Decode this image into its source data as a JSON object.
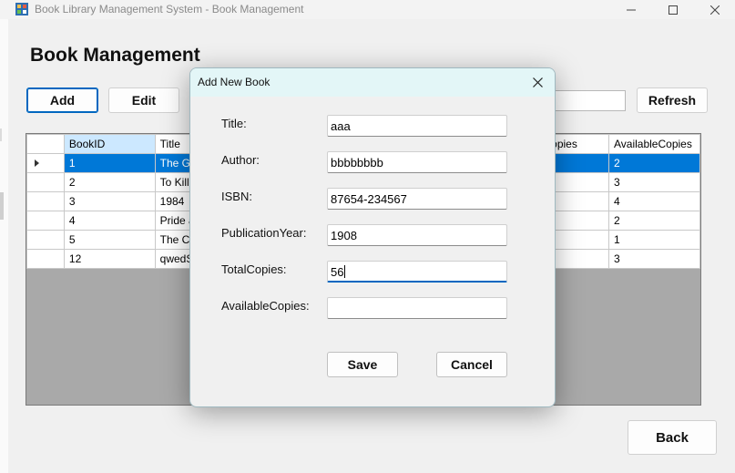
{
  "window": {
    "title": "Book Library Management System - Book Management",
    "app_icon": "app-icon",
    "controls": [
      "minimize-icon",
      "maximize-icon",
      "close-icon"
    ]
  },
  "page": {
    "title": "Book Management"
  },
  "toolbar": {
    "add_label": "Add",
    "edit_label": "Edit",
    "refresh_label": "Refresh",
    "search_value": ""
  },
  "grid": {
    "columns": [
      "BookID",
      "Title",
      "",
      "opies",
      "AvailableCopies"
    ],
    "rows": [
      {
        "id": "1",
        "title": "The Gr",
        "avail": "2",
        "selected": true
      },
      {
        "id": "2",
        "title": "To Kill a",
        "avail": "3",
        "selected": false
      },
      {
        "id": "3",
        "title": "1984",
        "avail": "4",
        "selected": false
      },
      {
        "id": "4",
        "title": "Pride an",
        "avail": "2",
        "selected": false
      },
      {
        "id": "5",
        "title": "The Ca",
        "avail": "1",
        "selected": false
      },
      {
        "id": "12",
        "title": "qwedSl",
        "avail": "3",
        "selected": false
      }
    ]
  },
  "dialog": {
    "title": "Add New Book",
    "fields": [
      {
        "label": "Title:",
        "value": "aaa"
      },
      {
        "label": "Author:",
        "value": "bbbbbbbb"
      },
      {
        "label": "ISBN:",
        "value": "87654-234567"
      },
      {
        "label": "PublicationYear:",
        "value": "1908"
      },
      {
        "label": "TotalCopies:",
        "value": "56"
      },
      {
        "label": "AvailableCopies:",
        "value": ""
      }
    ],
    "save_label": "Save",
    "cancel_label": "Cancel"
  },
  "footer": {
    "back_label": "Back"
  },
  "colors": {
    "accent": "#0078d7",
    "selected_header": "#cce8ff",
    "dialog_titlebar": "#e3f6f7",
    "grid_background": "#a9a9a9"
  }
}
